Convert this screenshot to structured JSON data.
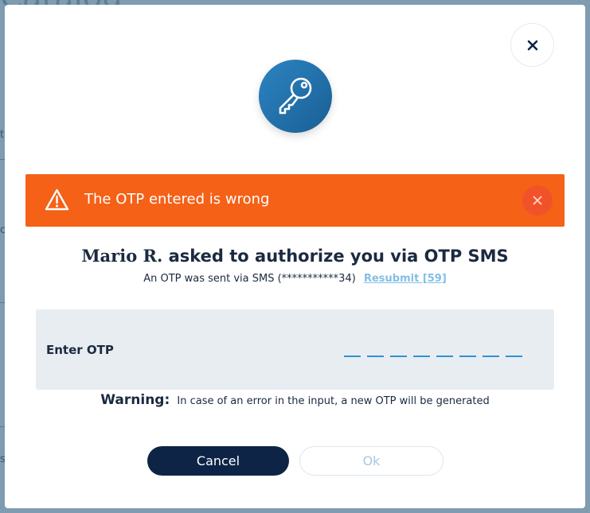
{
  "background": {
    "title_fragment": "Catalog",
    "edge_chars": [
      "t",
      "c",
      "s"
    ]
  },
  "modal": {
    "close_label": "×",
    "alert": {
      "message": "The OTP entered is wrong",
      "close_label": "×",
      "color": "#f46117"
    },
    "headline": {
      "name": "Mario R.",
      "text": " asked to authorize you via OTP SMS"
    },
    "subline": {
      "text": "An OTP was sent via SMS (***********34)",
      "resubmit_label": "Resubmit [59]"
    },
    "otp": {
      "label": "Enter OTP",
      "slot_count": 8,
      "values": [
        "",
        "",
        "",
        "",
        "",
        "",
        "",
        ""
      ]
    },
    "warning": {
      "label": "Warning:",
      "text": "In case of an error in the input, a new OTP will be generated"
    },
    "buttons": {
      "cancel": "Cancel",
      "ok": "Ok"
    }
  },
  "colors": {
    "primary_dark": "#0d2447",
    "accent_blue": "#2f92d6",
    "link_blue": "#82bfe6",
    "alert_orange": "#f46117"
  }
}
